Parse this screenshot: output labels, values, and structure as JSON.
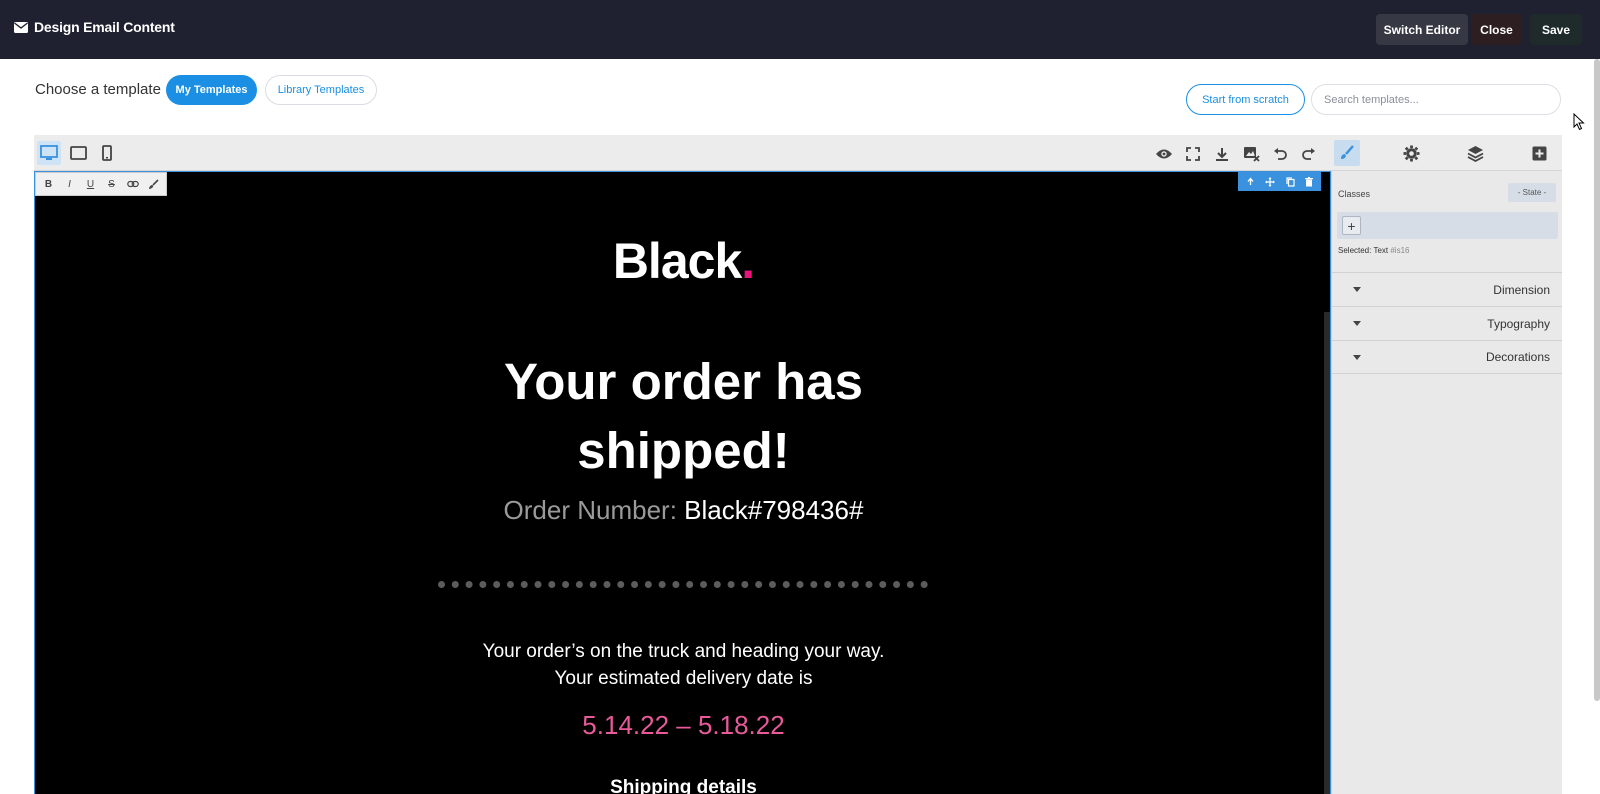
{
  "header": {
    "title": "Design Email Content",
    "switch_editor": "Switch Editor",
    "close": "Close",
    "save": "Save"
  },
  "chooser": {
    "label": "Choose a template",
    "my_templates": "My Templates",
    "library_templates": "Library Templates",
    "start_from_scratch": "Start from scratch",
    "search_placeholder": "Search templates..."
  },
  "rte": {
    "bold": "B",
    "italic": "I",
    "underline": "U",
    "strike": "S"
  },
  "panel": {
    "classes_label": "Classes",
    "state_select": "- State -",
    "add_tag": "+",
    "selected_label": "Selected:",
    "selected_type": "Text",
    "selected_id": "#is16",
    "sectors": [
      "Dimension",
      "Typography",
      "Decorations"
    ]
  },
  "email": {
    "logo_text": "Black",
    "logo_dot": ".",
    "headline_line1": "Your order has",
    "headline_line2": "shipped!",
    "order_label": "Order Number:",
    "order_number": "Black#798436#",
    "body_line1": "Your order’s on the truck and heading your way.",
    "body_line2": "Your estimated delivery date is",
    "date_range": "5.14.22 – 5.18.22",
    "shipping_details": "Shipping details"
  },
  "colors": {
    "topbar": "#1f2131",
    "accent": "#1a8fe3",
    "logo_dot": "#e8147a",
    "date_pink": "#e85a9a"
  }
}
